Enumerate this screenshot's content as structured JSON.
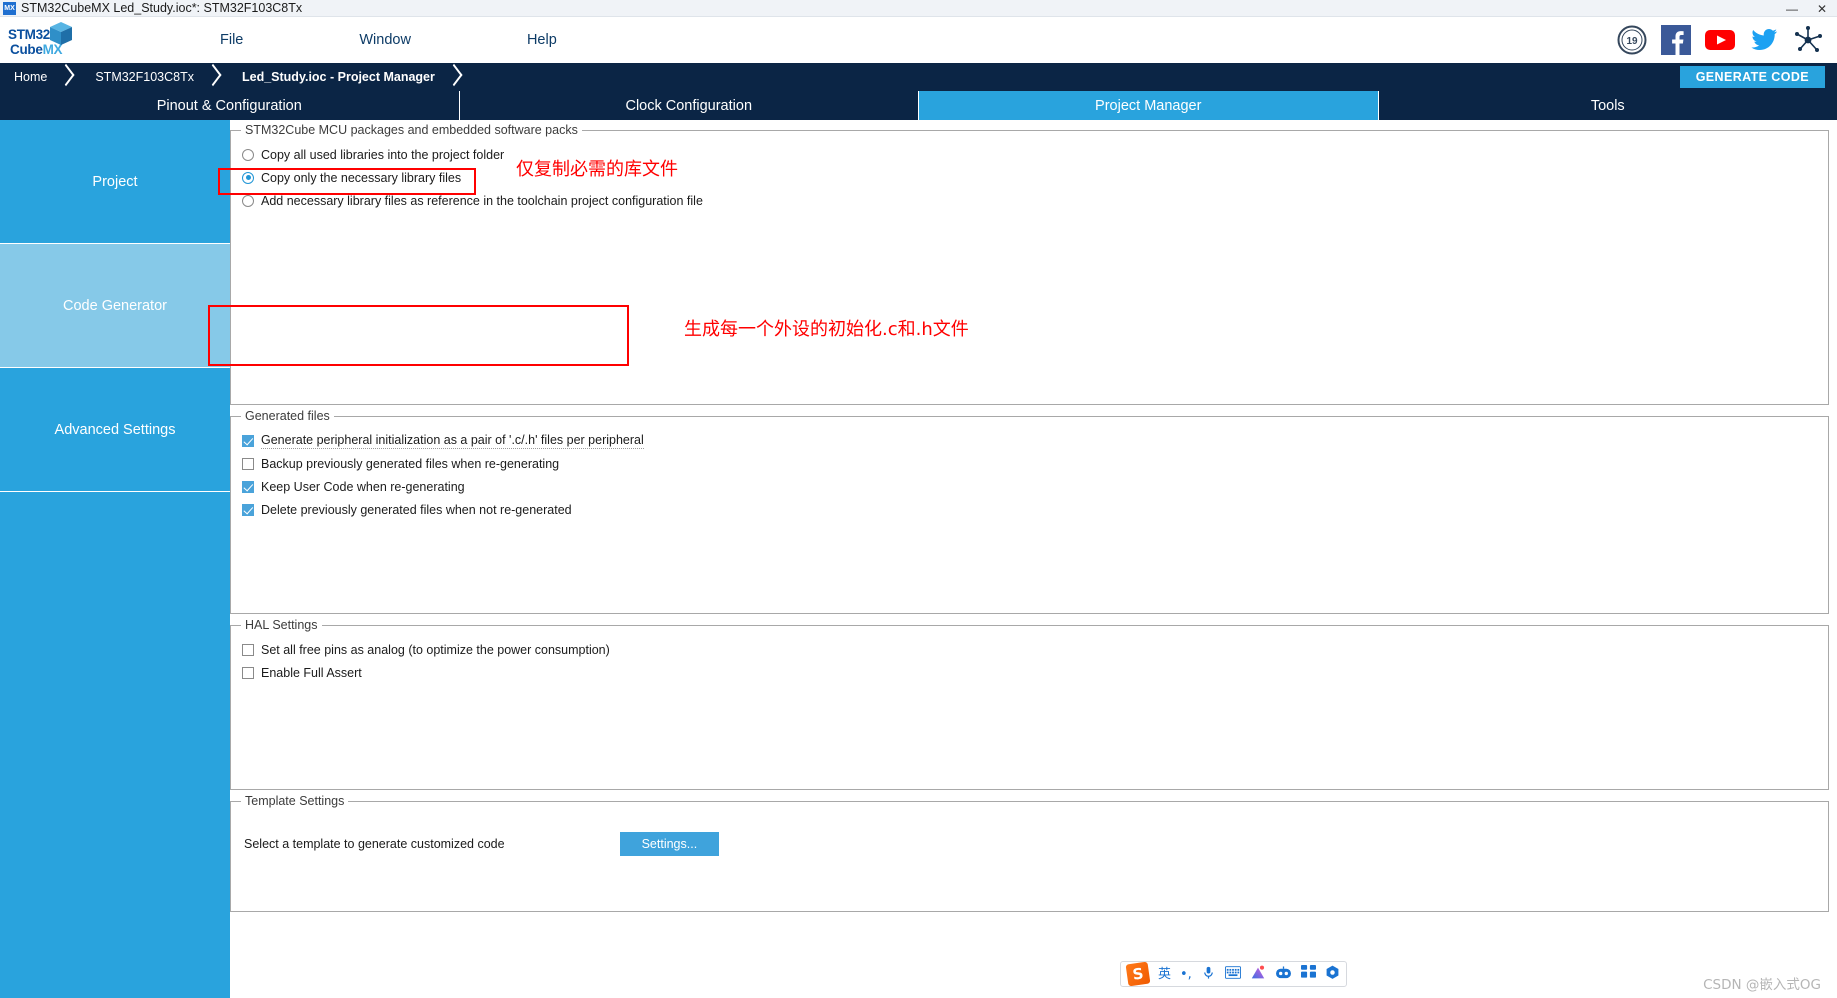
{
  "window": {
    "title": "STM32CubeMX Led_Study.ioc*: STM32F103C8Tx",
    "app_icon": "MX",
    "minimize_label": "—",
    "close_label": "✕"
  },
  "logo": {
    "line1_bold": "STM32",
    "line1_thin": "",
    "line2_bold": "Cube",
    "line2_thin": "MX"
  },
  "menubar": {
    "items": [
      {
        "label": "File",
        "name": "menu-file"
      },
      {
        "label": "Window",
        "name": "menu-window"
      },
      {
        "label": "Help",
        "name": "menu-help"
      }
    ],
    "social_icons": [
      {
        "name": "anniversary-badge-icon",
        "label": "19"
      },
      {
        "name": "facebook-icon",
        "label": "f"
      },
      {
        "name": "youtube-icon",
        "label": "▶"
      },
      {
        "name": "twitter-icon",
        "label": "🐦"
      },
      {
        "name": "network-share-icon",
        "label": "✳"
      }
    ]
  },
  "breadcrumb": {
    "items": [
      "Home",
      "STM32F103C8Tx",
      "Led_Study.ioc - Project Manager"
    ],
    "generate_code_label": "GENERATE CODE"
  },
  "main_tabs": [
    {
      "label": "Pinout & Configuration",
      "active": false
    },
    {
      "label": "Clock Configuration",
      "active": false
    },
    {
      "label": "Project Manager",
      "active": true
    },
    {
      "label": "Tools",
      "active": false
    }
  ],
  "sidebar": {
    "items": [
      {
        "label": "Project",
        "active": false
      },
      {
        "label": "Code Generator",
        "active": true
      },
      {
        "label": "Advanced Settings",
        "active": false
      }
    ]
  },
  "groups": {
    "packages": {
      "legend": "STM32Cube MCU packages and embedded software packs",
      "options": [
        {
          "label": "Copy all used libraries into the project folder",
          "checked": false
        },
        {
          "label": "Copy only the necessary library files",
          "checked": true
        },
        {
          "label": "Add necessary library files as reference in the toolchain project configuration file",
          "checked": false
        }
      ]
    },
    "generated_files": {
      "legend": "Generated files",
      "options": [
        {
          "label": "Generate peripheral initialization as a pair of '.c/.h' files per peripheral",
          "checked": true,
          "underline": true
        },
        {
          "label": "Backup previously generated files when re-generating",
          "checked": false,
          "underline": false
        },
        {
          "label": "Keep User Code when re-generating",
          "checked": true,
          "underline": false
        },
        {
          "label": "Delete previously generated files when not re-generated",
          "checked": true,
          "underline": false
        }
      ]
    },
    "hal_settings": {
      "legend": "HAL Settings",
      "options": [
        {
          "label": "Set all free pins as analog (to optimize the power consumption)",
          "checked": false
        },
        {
          "label": "Enable Full Assert",
          "checked": false
        }
      ]
    },
    "template_settings": {
      "legend": "Template Settings",
      "description": "Select a template to generate customized code",
      "settings_button": "Settings..."
    }
  },
  "annotations": [
    {
      "text": "仅复制必需的库文件",
      "name": "annotation-copy-necessary-library"
    },
    {
      "text": "生成每一个外设的初始化.c和.h文件",
      "name": "annotation-generate-peripheral-files"
    }
  ],
  "ime": {
    "logo": "S",
    "items": [
      "英",
      "•,",
      "🎤",
      "⌨",
      "🌈",
      "🤖",
      "❖",
      "⚙"
    ]
  },
  "watermark": "CSDN @嵌入式OG",
  "colors": {
    "accent_blue": "#29a3dd",
    "dark_navy": "#0b2545",
    "annotation_red": "#ff0000",
    "sidebar_active": "#86c9e8"
  }
}
